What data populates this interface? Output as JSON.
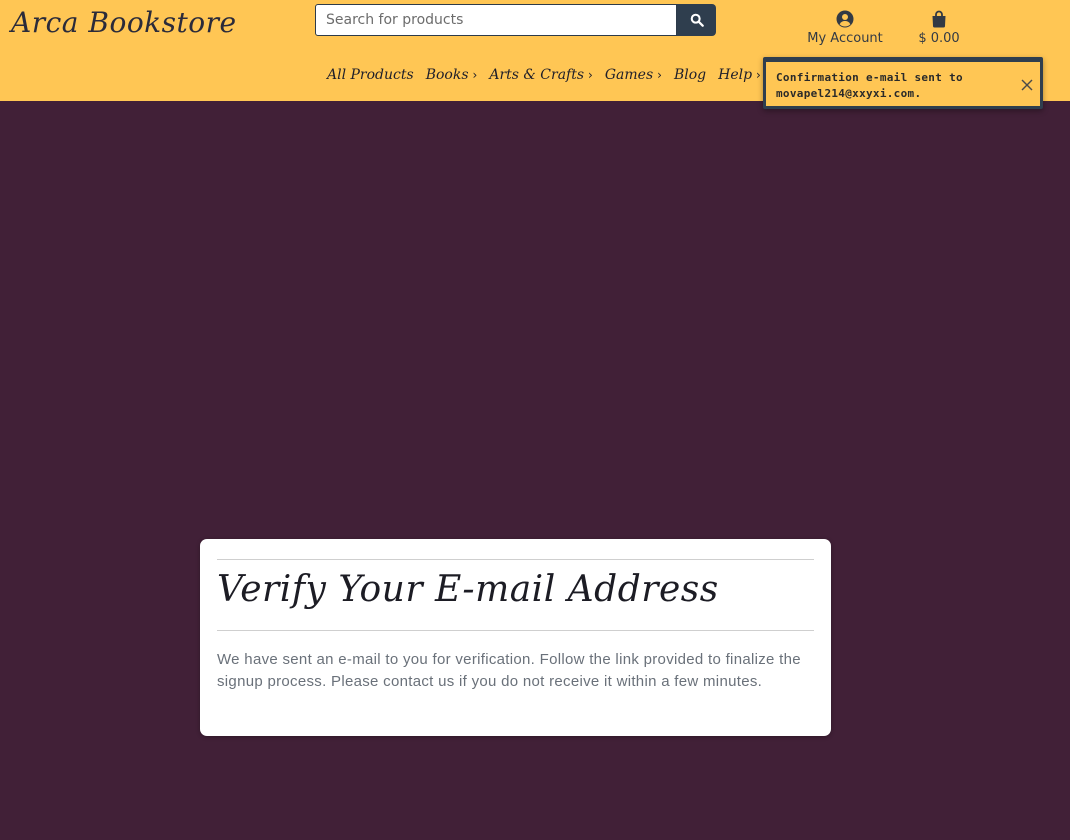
{
  "brand": {
    "logo_text": "Arca Bookstore"
  },
  "search": {
    "placeholder": "Search for products",
    "button_icon": "search-icon"
  },
  "account": {
    "label": "My Account",
    "icon": "user-circle-icon"
  },
  "cart": {
    "total": "$ 0.00",
    "icon": "shopping-bag-icon"
  },
  "nav": {
    "items": [
      {
        "label": "All Products",
        "has_submenu": false
      },
      {
        "label": "Books",
        "has_submenu": true
      },
      {
        "label": "Arts & Crafts",
        "has_submenu": true
      },
      {
        "label": "Games",
        "has_submenu": true
      },
      {
        "label": "Blog",
        "has_submenu": false
      },
      {
        "label": "Help",
        "has_submenu": true
      }
    ]
  },
  "toast": {
    "message": "Confirmation e-mail sent to movapel214@xxyxi.com.",
    "close_icon": "close-icon"
  },
  "card": {
    "title": "Verify Your E-mail Address",
    "body": "We have sent an e-mail to you for verification. Follow the link provided to finalize the signup process. Please contact us if you do not receive it within a few minutes."
  },
  "colors": {
    "header_bg": "#ffc654",
    "page_bg": "#412037",
    "accent_dark": "#2f3e4e",
    "card_bg": "#ffffff"
  }
}
